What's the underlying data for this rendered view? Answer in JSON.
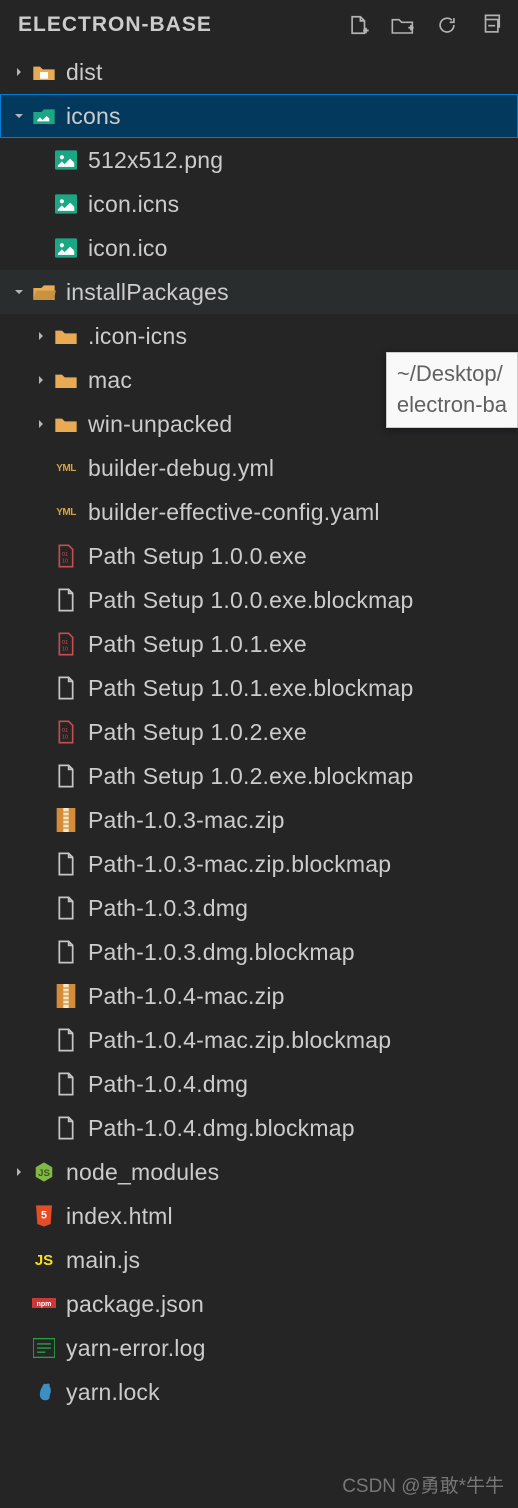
{
  "header": {
    "title": "ELECTRON-BASE"
  },
  "tooltip": {
    "line1": "~/Desktop/",
    "line2": "electron-ba"
  },
  "watermark": "CSDN @勇敢*牛牛",
  "tree": [
    {
      "depth": 0,
      "chev": "right",
      "icon": "folder-dist",
      "label": "dist"
    },
    {
      "depth": 0,
      "chev": "down",
      "icon": "folder-icons",
      "label": "icons",
      "selected": true
    },
    {
      "depth": 1,
      "chev": "none",
      "icon": "image",
      "label": "512x512.png"
    },
    {
      "depth": 1,
      "chev": "none",
      "icon": "image",
      "label": "icon.icns"
    },
    {
      "depth": 1,
      "chev": "none",
      "icon": "image",
      "label": "icon.ico"
    },
    {
      "depth": 0,
      "chev": "down",
      "icon": "folder-open",
      "label": "installPackages",
      "hover": true
    },
    {
      "depth": 1,
      "chev": "right",
      "icon": "folder",
      "label": ".icon-icns"
    },
    {
      "depth": 1,
      "chev": "right",
      "icon": "folder",
      "label": "mac"
    },
    {
      "depth": 1,
      "chev": "right",
      "icon": "folder",
      "label": "win-unpacked"
    },
    {
      "depth": 1,
      "chev": "none",
      "icon": "yaml",
      "label": "builder-debug.yml"
    },
    {
      "depth": 1,
      "chev": "none",
      "icon": "yaml",
      "label": "builder-effective-config.yaml"
    },
    {
      "depth": 1,
      "chev": "none",
      "icon": "bin",
      "label": "Path Setup 1.0.0.exe"
    },
    {
      "depth": 1,
      "chev": "none",
      "icon": "file",
      "label": "Path Setup 1.0.0.exe.blockmap"
    },
    {
      "depth": 1,
      "chev": "none",
      "icon": "bin",
      "label": "Path Setup 1.0.1.exe"
    },
    {
      "depth": 1,
      "chev": "none",
      "icon": "file",
      "label": "Path Setup 1.0.1.exe.blockmap"
    },
    {
      "depth": 1,
      "chev": "none",
      "icon": "bin",
      "label": "Path Setup 1.0.2.exe"
    },
    {
      "depth": 1,
      "chev": "none",
      "icon": "file",
      "label": "Path Setup 1.0.2.exe.blockmap"
    },
    {
      "depth": 1,
      "chev": "none",
      "icon": "zip",
      "label": "Path-1.0.3-mac.zip"
    },
    {
      "depth": 1,
      "chev": "none",
      "icon": "file",
      "label": "Path-1.0.3-mac.zip.blockmap"
    },
    {
      "depth": 1,
      "chev": "none",
      "icon": "file",
      "label": "Path-1.0.3.dmg"
    },
    {
      "depth": 1,
      "chev": "none",
      "icon": "file",
      "label": "Path-1.0.3.dmg.blockmap"
    },
    {
      "depth": 1,
      "chev": "none",
      "icon": "zip",
      "label": "Path-1.0.4-mac.zip"
    },
    {
      "depth": 1,
      "chev": "none",
      "icon": "file",
      "label": "Path-1.0.4-mac.zip.blockmap"
    },
    {
      "depth": 1,
      "chev": "none",
      "icon": "file",
      "label": "Path-1.0.4.dmg"
    },
    {
      "depth": 1,
      "chev": "none",
      "icon": "file",
      "label": "Path-1.0.4.dmg.blockmap"
    },
    {
      "depth": 0,
      "chev": "right",
      "icon": "node",
      "label": "node_modules"
    },
    {
      "depth": 0,
      "chev": "none",
      "icon": "html",
      "label": "index.html"
    },
    {
      "depth": 0,
      "chev": "none",
      "icon": "js",
      "label": "main.js"
    },
    {
      "depth": 0,
      "chev": "none",
      "icon": "npm",
      "label": "package.json"
    },
    {
      "depth": 0,
      "chev": "none",
      "icon": "log",
      "label": "yarn-error.log"
    },
    {
      "depth": 0,
      "chev": "none",
      "icon": "yarn",
      "label": "yarn.lock"
    }
  ]
}
